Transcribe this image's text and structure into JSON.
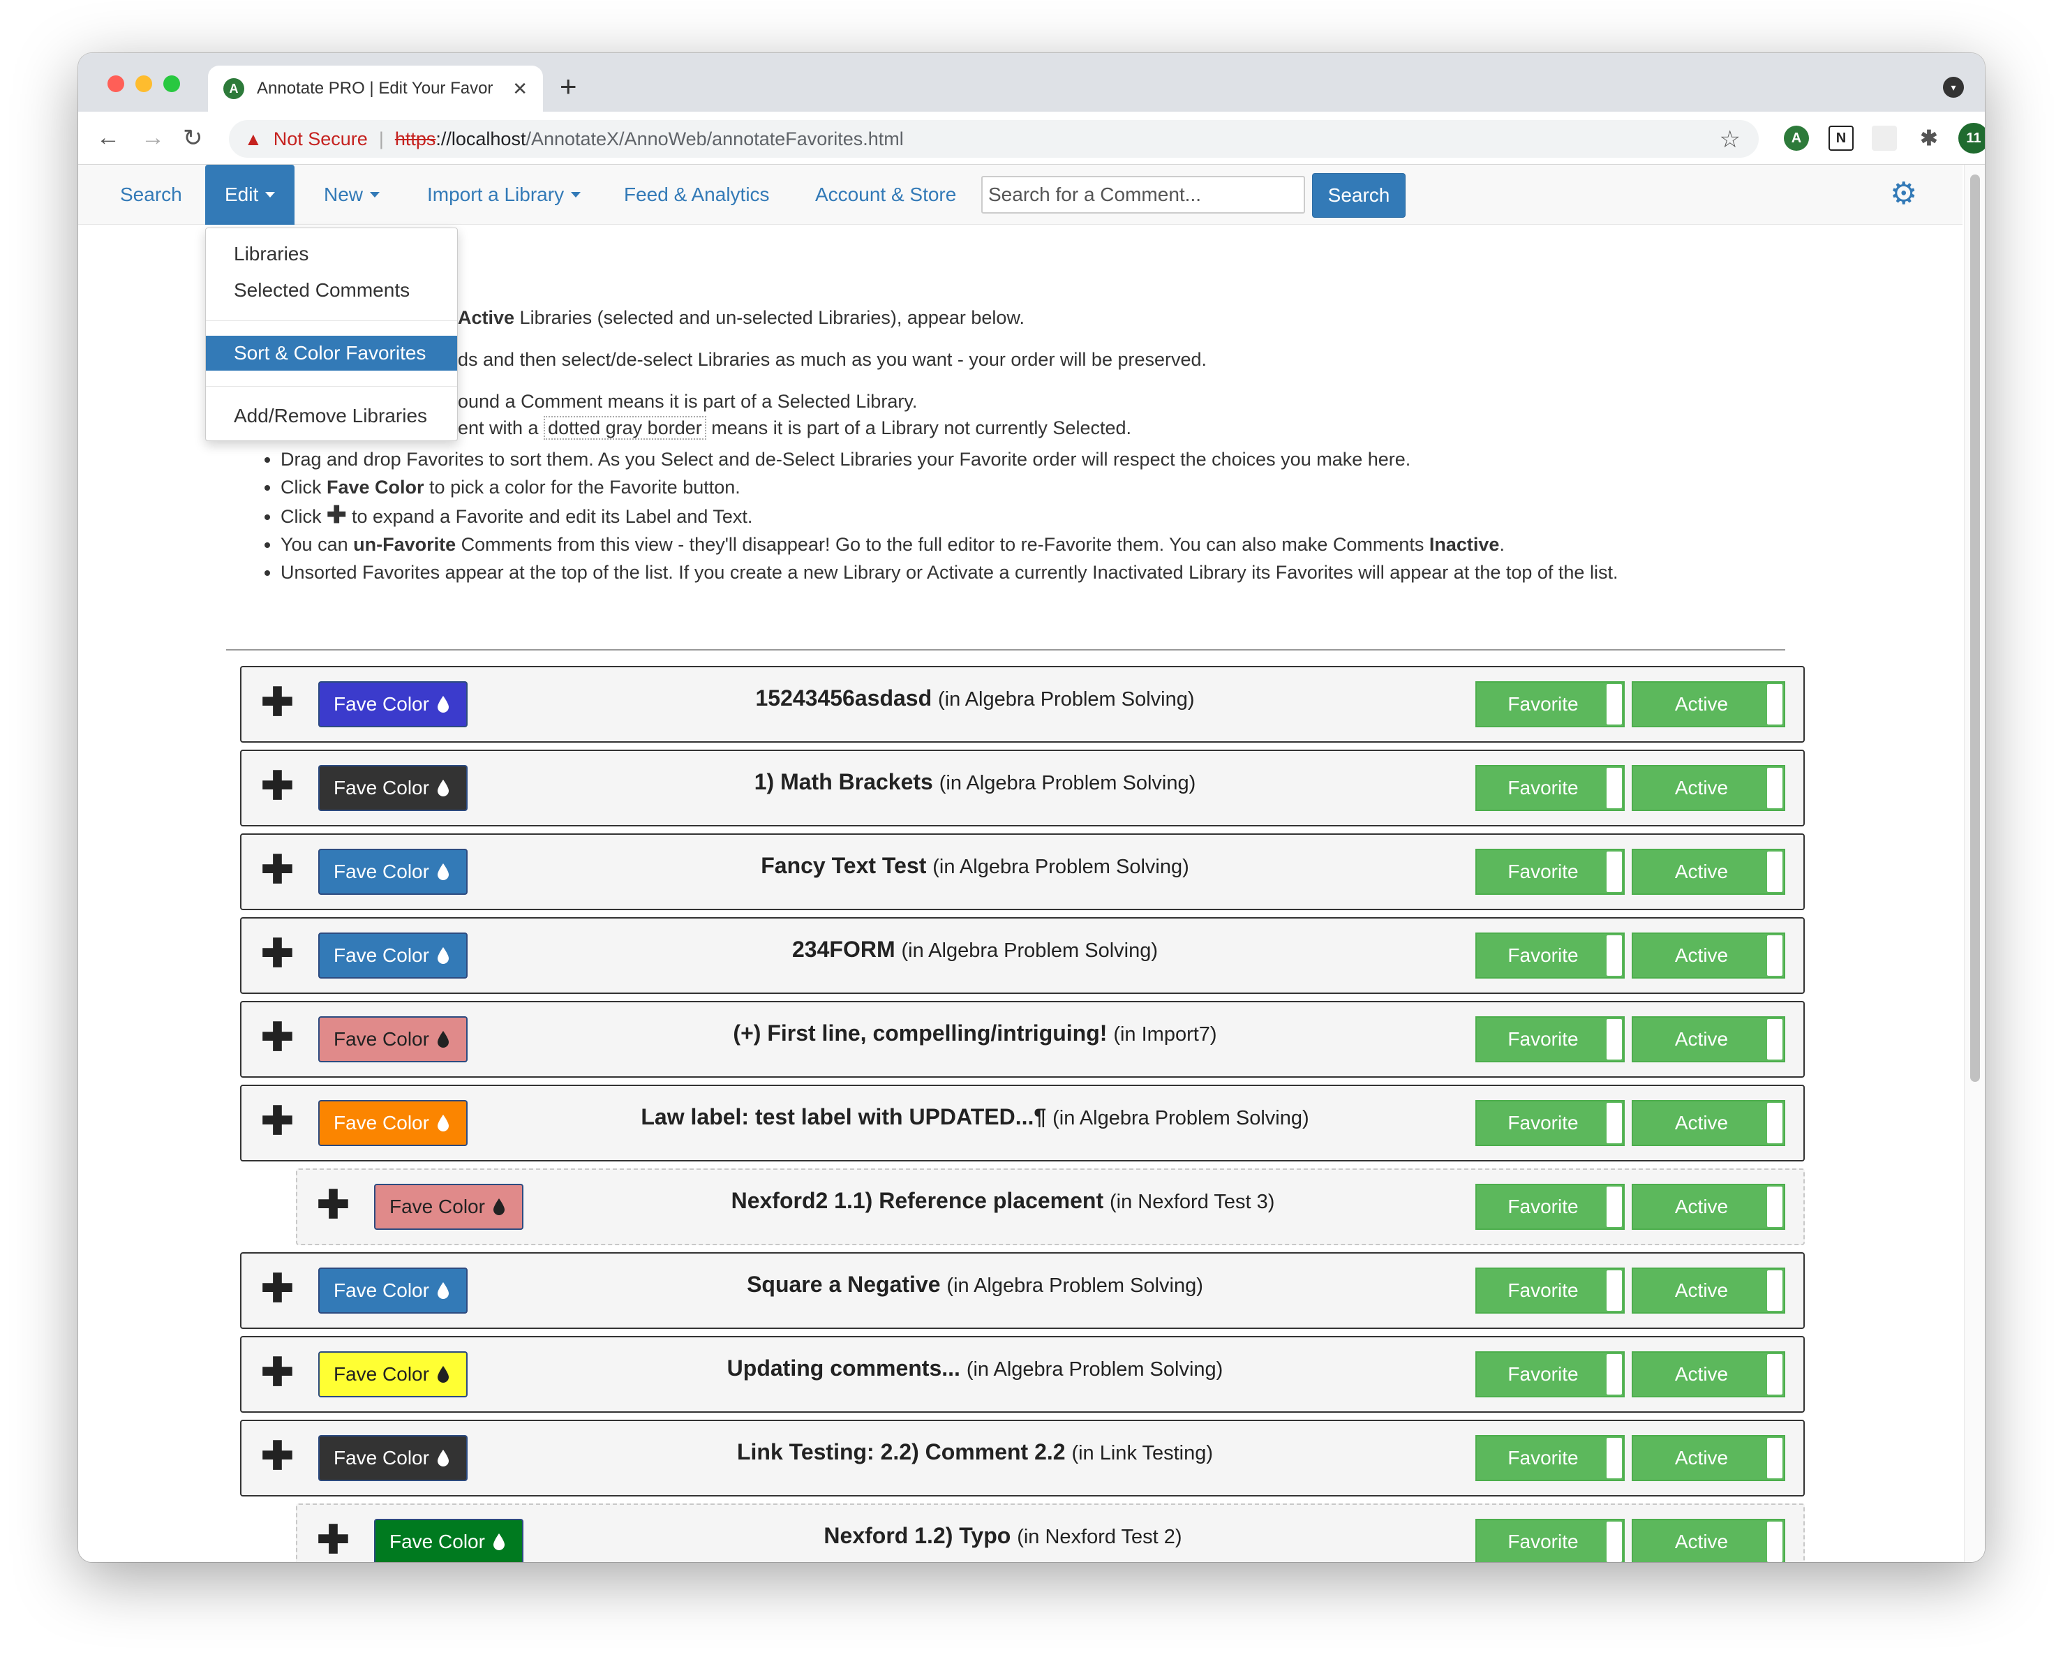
{
  "browser": {
    "tab_title": "Annotate PRO | Edit Your Favor",
    "tab_favicon": "A",
    "security": "Not Secure",
    "url_scheme": "https",
    "url_rest_host": "://localhost",
    "url_path": "/AnnotateX/AnnoWeb/annotateFavorites.html",
    "ext_count": "11"
  },
  "nav": {
    "search": "Search",
    "edit": "Edit",
    "new": "New",
    "import": "Import a Library",
    "feed": "Feed & Analytics",
    "account": "Account & Store",
    "search_placeholder": "Search for a Comment...",
    "search_button": "Search"
  },
  "dropdown": {
    "items": [
      "Libraries",
      "Selected Comments",
      "Sort & Color Favorites",
      "Add/Remove Libraries"
    ]
  },
  "intro": {
    "line1_bold": "Active",
    "line1_rest": " Libraries (selected and un-selected Libraries), appear below.",
    "line2": "ds and then select/de-select Libraries as much as you want - your order will be preserved.",
    "line3": "ound a Comment means it is part of a Selected Library.",
    "line4_a": "ent with a ",
    "line4_dotted": "dotted gray border",
    "line4_b": " means it is part of a Library not currently Selected."
  },
  "bullets": {
    "b1": "Drag and drop Favorites to sort them. As you Select and de-Select Libraries your Favorite order will respect the choices you make here.",
    "b2_a": "Click ",
    "b2_bold": "Fave Color",
    "b2_b": " to pick a color for the Favorite button.",
    "b3_a": "Click ",
    "b3_plus": "✚",
    "b3_b": " to expand a Favorite and edit its Label and Text.",
    "b4_a": "You can ",
    "b4_bold": "un-Favorite",
    "b4_b": " Comments from this view - they'll disappear! Go to the full editor to re-Favorite them. You can also make Comments ",
    "b4_bold2": "Inactive",
    "b4_c": ".",
    "b5": "Unsorted Favorites appear at the top of the list. If you create a new Library or Activate a currently Inactivated Library its Favorites will appear at the top of the list."
  },
  "favorites": [
    {
      "label": "15243456asdasd",
      "library": "(in Algebra Problem Solving)",
      "color": "#3b3bcc",
      "text_color": "#ffffff",
      "selected": true
    },
    {
      "label": "1) Math Brackets",
      "library": "(in Algebra Problem Solving)",
      "color": "#333333",
      "text_color": "#ffffff",
      "selected": true
    },
    {
      "label": "Fancy Text Test",
      "library": "(in Algebra Problem Solving)",
      "color": "#337ab7",
      "text_color": "#ffffff",
      "selected": true
    },
    {
      "label": "234FORM",
      "library": "(in Algebra Problem Solving)",
      "color": "#337ab7",
      "text_color": "#ffffff",
      "selected": true
    },
    {
      "label": "(+) First line, compelling/intriguing!",
      "library": "(in Import7)",
      "color": "#e08a8a",
      "text_color": "#222222",
      "selected": true
    },
    {
      "label": "Law label: test label with UPDATED...¶",
      "library": "(in Algebra Problem Solving)",
      "color": "#fb8500",
      "text_color": "#ffffff",
      "selected": true
    },
    {
      "label": "Nexford2 1.1) Reference placement",
      "library": "(in Nexford Test 3)",
      "color": "#e08a8a",
      "text_color": "#222222",
      "selected": false
    },
    {
      "label": "Square a Negative",
      "library": "(in Algebra Problem Solving)",
      "color": "#337ab7",
      "text_color": "#ffffff",
      "selected": true
    },
    {
      "label": "Updating comments...",
      "library": "(in Algebra Problem Solving)",
      "color": "#ffff33",
      "text_color": "#222222",
      "selected": true
    },
    {
      "label": "Link Testing: 2.2) Comment 2.2",
      "library": "(in Link Testing)",
      "color": "#333333",
      "text_color": "#ffffff",
      "selected": true
    },
    {
      "label": "Nexford 1.2) Typo",
      "library": "(in Nexford Test 2)",
      "color": "#007a1f",
      "text_color": "#ffffff",
      "selected": false
    }
  ],
  "row_labels": {
    "fave_color": "Fave Color",
    "favorite": "Favorite",
    "active": "Active"
  }
}
